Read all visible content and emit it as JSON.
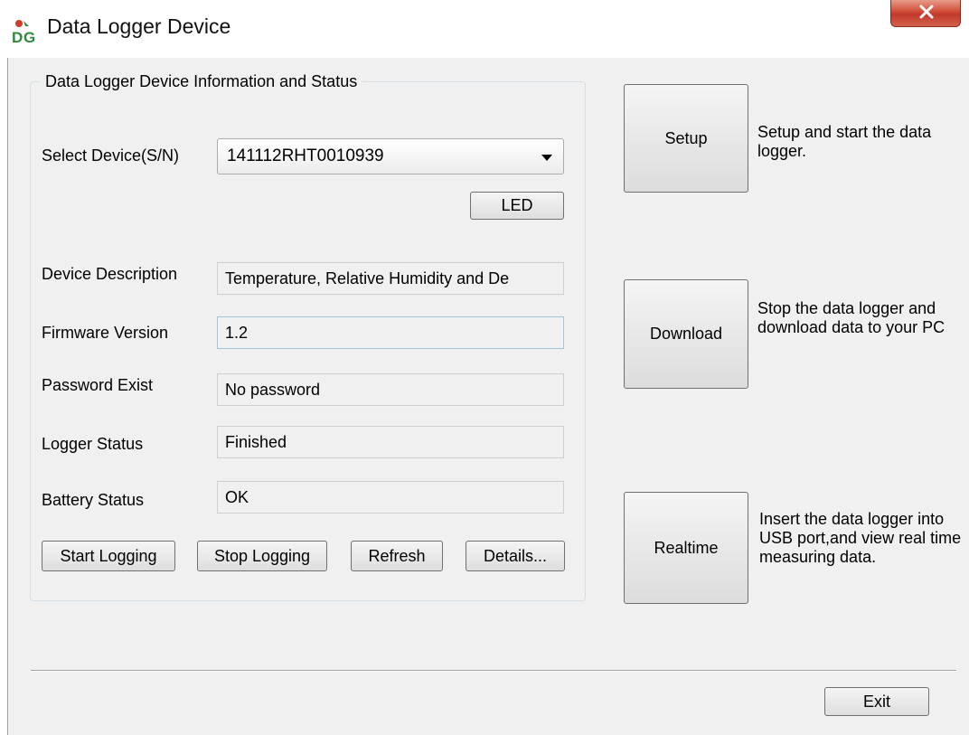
{
  "window": {
    "title": "Data Logger Device",
    "icon": "dg-logo-icon"
  },
  "group": {
    "legend": "Data Logger Device Information and Status",
    "select_device_label": "Select Device(S/N)",
    "selected_device": "141112RHT0010939",
    "led_label": "LED",
    "fields": [
      {
        "label": "Device Description",
        "value": "Temperature, Relative Humidity and De"
      },
      {
        "label": "Firmware Version",
        "value": "1.2"
      },
      {
        "label": "Password Exist",
        "value": "No password"
      },
      {
        "label": "Logger Status",
        "value": "Finished"
      },
      {
        "label": "Battery Status",
        "value": "OK"
      }
    ],
    "buttons": [
      "Start Logging",
      "Stop Logging",
      "Refresh",
      "Details..."
    ]
  },
  "actions": [
    {
      "label": "Setup",
      "description": "Setup and start the data logger."
    },
    {
      "label": "Download",
      "description": "Stop the data logger and download data to your PC"
    },
    {
      "label": "Realtime",
      "description": "Insert the data logger into USB port,and view real time measuring data."
    }
  ],
  "exit_label": "Exit",
  "colors": {
    "close_button": "#c0392b",
    "logo_green": "#2e8b3e",
    "logo_red": "#d23a2a"
  }
}
